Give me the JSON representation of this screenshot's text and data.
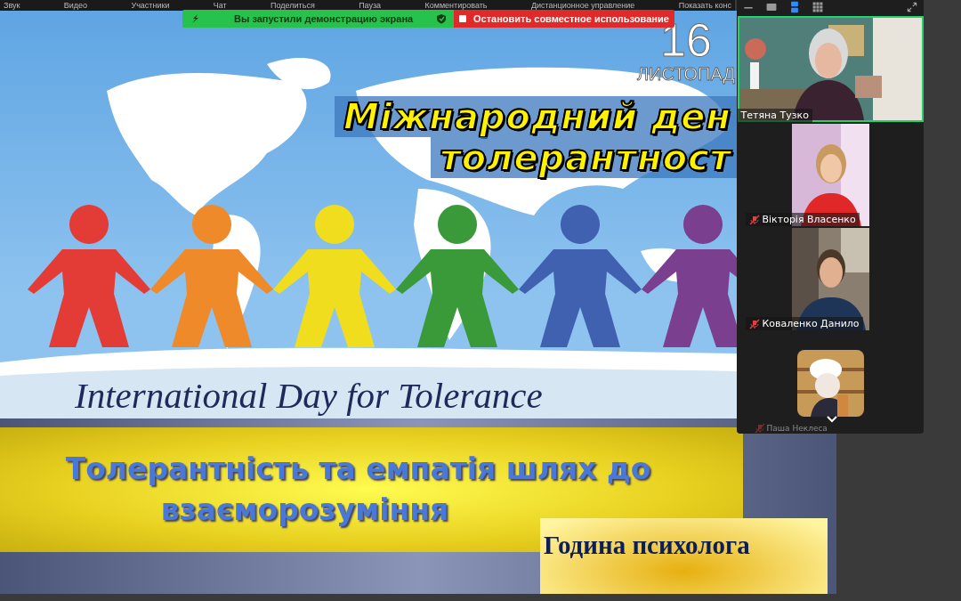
{
  "menu_bar": {
    "items": [
      "Звук",
      "Видео",
      "Участники",
      "Чат",
      "Поделиться",
      "Пауза",
      "Комментировать",
      "Дистанционное управление",
      "Показать конс"
    ]
  },
  "share_banner": {
    "status": "Вы запустили демонстрацию экрана",
    "stop_button": "Остановить совместное использование"
  },
  "slide": {
    "date_day": "16",
    "date_month": "ЛИСТОПАД",
    "title_lines": [
      "Міжнародний ден",
      "толерантност"
    ],
    "figures": [
      {
        "color": "#e33b35"
      },
      {
        "color": "#ee8a2a"
      },
      {
        "color": "#f0dd1e"
      },
      {
        "color": "#3a9a3a"
      },
      {
        "color": "#4060b0"
      },
      {
        "color": "#7b3f8f"
      }
    ],
    "subtitle": "International Day for Tolerance",
    "topic_lines": [
      "Толерантність та емпатія шлях до",
      "взаєморозуміння"
    ],
    "badge": "Година психолога"
  },
  "participants_panel": {
    "view_buttons": [
      {
        "kind": "minimize",
        "selected": false
      },
      {
        "kind": "speaker",
        "selected": false
      },
      {
        "kind": "strip",
        "selected": true
      },
      {
        "kind": "grid",
        "selected": false
      }
    ],
    "participants": [
      {
        "name": "Тетяна Тузко",
        "muted": false,
        "speaking": true,
        "kind": "wide"
      },
      {
        "name": "Вікторія Власенко",
        "muted": true,
        "speaking": false,
        "kind": "narrow"
      },
      {
        "name": "Коваленко Данило",
        "muted": true,
        "speaking": false,
        "kind": "narrow"
      },
      {
        "name": "Паша Неклеса",
        "muted": true,
        "speaking": false,
        "kind": "avatar"
      }
    ]
  }
}
